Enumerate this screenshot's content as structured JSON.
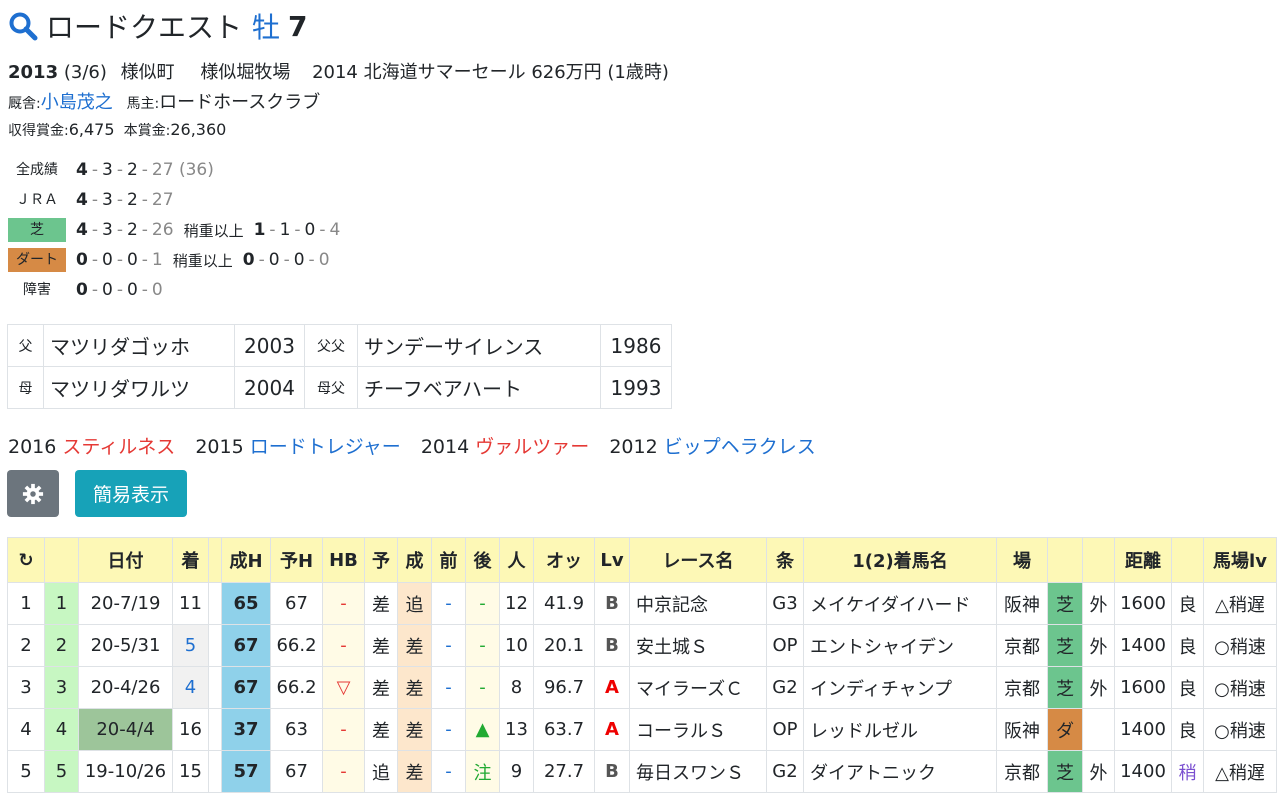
{
  "horse": {
    "name": "ロードクエスト",
    "sex": "牡",
    "age": "7"
  },
  "info": {
    "year": "2013",
    "birthday": "(3/6)",
    "region": "様似町",
    "breeder": "様似堀牧場",
    "sale": "2014 北海道サマーセール 626万円 (1歳時)",
    "trainer_label": "厩舎:",
    "trainer": "小島茂之",
    "owner_label": "馬主:",
    "owner": "ロードホースクラブ",
    "earn_label": "収得賞金:",
    "earn": "6,475",
    "prize_label": "本賞金:",
    "prize": "26,360"
  },
  "records": {
    "all": {
      "label": "全成績",
      "w": "4",
      "s": "3",
      "t": "2",
      "o": "27 (36)"
    },
    "jra": {
      "label": "ＪＲＡ",
      "w": "4",
      "s": "3",
      "t": "2",
      "o": "27"
    },
    "turf": {
      "label": "芝",
      "w": "4",
      "s": "3",
      "t": "2",
      "o": "26",
      "sub": "稍重以上",
      "w2": "1",
      "s2": "1",
      "t2": "0",
      "o2": "4"
    },
    "dirt": {
      "label": "ダート",
      "w": "0",
      "s": "0",
      "t": "0",
      "o": "1",
      "sub": "稍重以上",
      "w2": "0",
      "s2": "0",
      "t2": "0",
      "o2": "0"
    },
    "jump": {
      "label": "障害",
      "w": "0",
      "s": "0",
      "t": "0",
      "o": "0"
    }
  },
  "pedigree": {
    "sire_label": "父",
    "sire": "マツリダゴッホ",
    "sire_year": "2003",
    "ss_label": "父父",
    "ss": "サンデーサイレンス",
    "ss_year": "1986",
    "dam_label": "母",
    "dam": "マツリダワルツ",
    "dam_year": "2004",
    "ds_label": "母父",
    "ds": "チーフベアハート",
    "ds_year": "1993"
  },
  "progeny": [
    {
      "year": "2016",
      "name": "スティルネス"
    },
    {
      "year": "2015",
      "name": "ロードトレジャー"
    },
    {
      "year": "2014",
      "name": "ヴァルツァー"
    },
    {
      "year": "2012",
      "name": "ビップヘラクレス"
    }
  ],
  "buttons": {
    "settings_icon": "gear-icon",
    "simple": "簡易表示"
  },
  "table": {
    "headers": [
      "↻",
      "",
      "日付",
      "着",
      "",
      "成H",
      "予H",
      "HB",
      "予",
      "成",
      "前",
      "後",
      "人",
      "オッ",
      "Lv",
      "レース名",
      "条",
      "1(2)着馬名",
      "場",
      "",
      "",
      "距離",
      "",
      "馬場lv"
    ],
    "rows": [
      [
        "1",
        "1",
        "20-7/19",
        "11",
        "",
        "65",
        "67",
        "-",
        "差",
        "追",
        "-",
        "-",
        "12",
        "41.9",
        "B",
        "中京記念",
        "G3",
        "メイケイダイハード",
        "阪神",
        "芝",
        "外",
        "1600",
        "良",
        "△稍遅"
      ],
      [
        "2",
        "2",
        "20-5/31",
        "5",
        "",
        "67",
        "66.2",
        "-",
        "差",
        "差",
        "-",
        "-",
        "10",
        "20.1",
        "B",
        "安土城Ｓ",
        "OP",
        "エントシャイデン",
        "京都",
        "芝",
        "外",
        "1400",
        "良",
        "○稍速"
      ],
      [
        "3",
        "3",
        "20-4/26",
        "4",
        "",
        "67",
        "66.2",
        "▽",
        "差",
        "差",
        "-",
        "-",
        "8",
        "96.7",
        "A",
        "マイラーズＣ",
        "G2",
        "インディチャンプ",
        "京都",
        "芝",
        "外",
        "1600",
        "良",
        "○稍速"
      ],
      [
        "4",
        "4",
        "20-4/4",
        "16",
        "",
        "37",
        "63",
        "-",
        "差",
        "差",
        "-",
        "▲",
        "13",
        "63.7",
        "A",
        "コーラルＳ",
        "OP",
        "レッドルゼル",
        "阪神",
        "ダ",
        "",
        "1400",
        "良",
        "○稍速"
      ],
      [
        "5",
        "5",
        "19-10/26",
        "15",
        "",
        "57",
        "67",
        "-",
        "追",
        "差",
        "-",
        "注",
        "9",
        "27.7",
        "B",
        "毎日スワンＳ",
        "G2",
        "ダイアトニック",
        "京都",
        "芝",
        "外",
        "1400",
        "稍",
        "△稍遅"
      ]
    ]
  }
}
